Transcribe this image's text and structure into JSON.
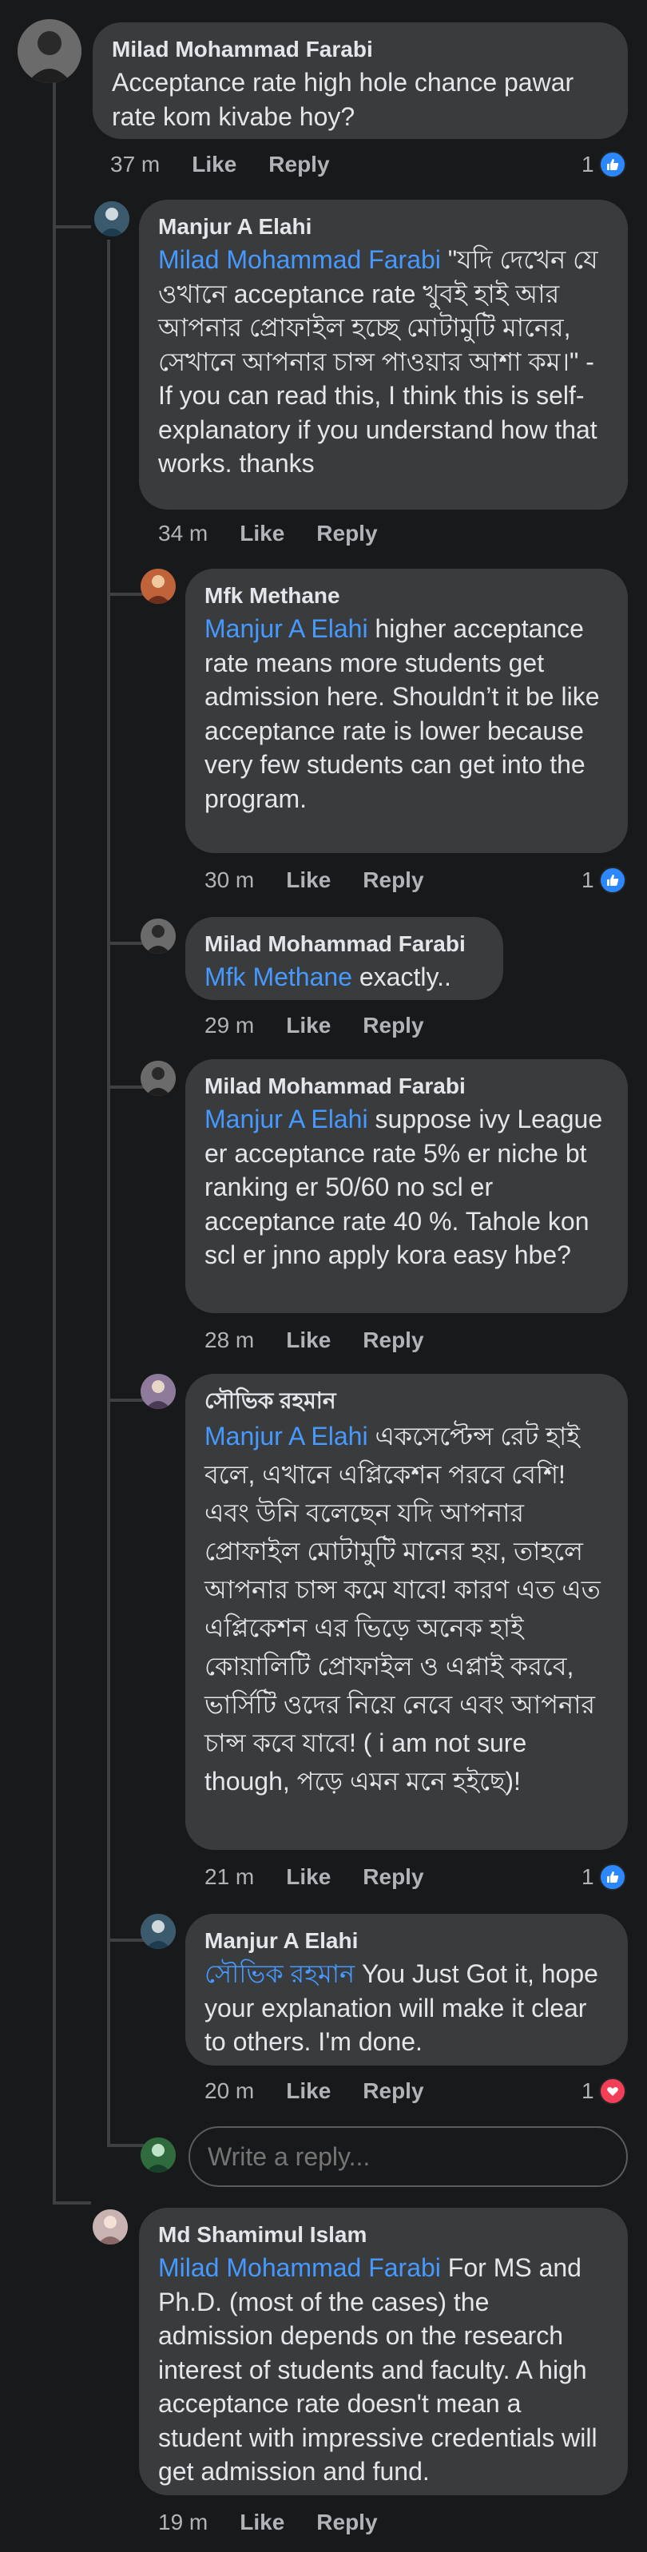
{
  "actions": {
    "like": "Like",
    "reply": "Reply"
  },
  "colors": {
    "background": "#18191a",
    "bubble": "#3a3b3c",
    "mention": "#4599ff",
    "meta": "#b0b3b8",
    "like_blue": "#2d88ff",
    "love_red": "#f33e58"
  },
  "comments": [
    {
      "author": "Milad Mohammad Farabi",
      "mention": "",
      "text": "Acceptance rate high hole chance pawar rate kom kivabe hoy?",
      "time": "37 m",
      "reaction_count": "1",
      "reaction_icon": "like-icon"
    },
    {
      "author": "Manjur A Elahi",
      "mention": "Milad Mohammad Farabi",
      "text": " \"যদি দেখেন যে ওখানে acceptance rate খুবই হাই আর আপনার প্রোফাইল হচ্ছে মোটামুটি মানের, সেখানে আপনার চান্স পাওয়ার আশা কম।\" - If you can read this, I think this is self-explanatory if you understand how that works. thanks",
      "time": "34 m",
      "reaction_count": "",
      "reaction_icon": ""
    },
    {
      "author": "Mfk Methane",
      "mention": "Manjur A Elahi",
      "text": " higher acceptance rate means more students get admission here. Shouldn’t it be like acceptance rate is lower because very few students can get into the program.",
      "time": "30 m",
      "reaction_count": "1",
      "reaction_icon": "like-icon"
    },
    {
      "author": "Milad Mohammad Farabi",
      "mention": "Mfk Methane",
      "text": " exactly..",
      "time": "29 m",
      "reaction_count": "",
      "reaction_icon": ""
    },
    {
      "author": "Milad Mohammad Farabi",
      "mention": "Manjur A Elahi",
      "text": " suppose ivy League er acceptance rate 5% er niche bt ranking er 50/60 no scl er acceptance rate 40 %. Tahole kon scl er jnno apply kora easy hbe?",
      "time": "28 m",
      "reaction_count": "",
      "reaction_icon": ""
    },
    {
      "author": "সৌভিক রহমান",
      "mention": "Manjur A Elahi",
      "text": " একসেপ্টেন্স রেট হাই বলে,  এখানে এপ্লিকেশন পরবে বেশি!  এবং উনি বলেছেন যদি আপনার প্রোফাইল মোটামুটি মানের হয়, তাহলে আপনার চান্স কমে যাবে! কারণ এত এত এপ্লিকেশন এর ভিড়ে অনেক হাই কোয়ালিটি প্রোফাইল ও এপ্লাই করবে,  ভার্সিটি ওদের নিয়ে নেবে এবং আপনার চান্স কবে যাবে! ( i am not sure though,  পড়ে এমন মনে হইছে)!",
      "time": "21 m",
      "reaction_count": "1",
      "reaction_icon": "like-icon"
    },
    {
      "author": "Manjur A Elahi",
      "mention": "সৌভিক রহমান",
      "text": " You Just Got it, hope your explanation will make it clear to others. I'm done.",
      "time": "20 m",
      "reaction_count": "1",
      "reaction_icon": "love-icon"
    },
    {
      "author": "Md Shamimul Islam",
      "mention": "Milad Mohammad Farabi",
      "text": " For MS and Ph.D. (most of the cases) the admission depends on the research interest of students and faculty. A high acceptance rate doesn't mean a student with impressive credentials will get admission and fund.",
      "time": "19 m",
      "reaction_count": "",
      "reaction_icon": ""
    }
  ],
  "reply_box": {
    "placeholder": "Write a reply..."
  }
}
